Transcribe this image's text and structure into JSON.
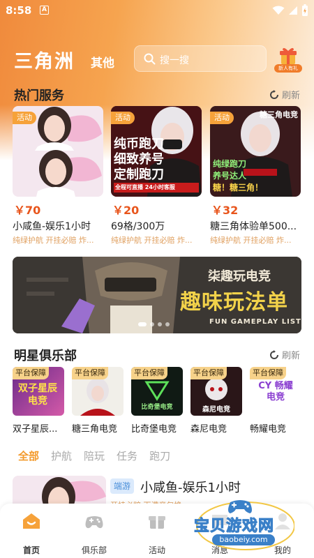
{
  "status_bar": {
    "time": "8:58",
    "notification_icon": "A"
  },
  "header": {
    "brand": "三角洲",
    "subtitle": "其他",
    "search_placeholder": "搜一搜",
    "gift_label": "新人有礼"
  },
  "hot_services": {
    "title": "热门服务",
    "refresh_label": "刷新",
    "cards": [
      {
        "tag": "活动",
        "price": "￥70",
        "title": "小咸鱼-娱乐1小时",
        "tags": "纯绿护航  开挂必赔  炸..."
      },
      {
        "tag": "活动",
        "price": "￥20",
        "title": "69格/300万",
        "tags": "纯绿护航  开挂必赔  炸...",
        "image_text": [
          "纯币跑刀",
          "细致养号",
          "定制跑刀",
          "全程可直播 24小时客服"
        ]
      },
      {
        "tag": "活动",
        "price": "￥32",
        "title": "糖三角体验单500...",
        "tags": "纯绿护航  开挂必赔  炸...",
        "image_text": [
          "糖三角电竞",
          "纯绿跑刀",
          "养号达人",
          "糖！糖三角！"
        ]
      }
    ]
  },
  "banner": {
    "line1": "柒趣玩电竞",
    "line2": "趣味玩法单",
    "line3": "FUN GAMEPLAY LIST",
    "slides": 4,
    "active_slide": 0
  },
  "star_clubs": {
    "title": "明星俱乐部",
    "refresh_label": "刷新",
    "badge": "平台保障",
    "clubs": [
      {
        "name": "双子星辰...",
        "logo_text": "双子星辰电竞"
      },
      {
        "name": "糖三角电竞",
        "logo_text": ""
      },
      {
        "name": "比奇堡电竞",
        "logo_text": "比奇堡电竞"
      },
      {
        "name": "森尼电竞",
        "logo_text": "森尼电竞"
      },
      {
        "name": "畅耀电竞",
        "logo_text": "CY 畅耀电竞"
      }
    ]
  },
  "filters": [
    "全部",
    "护航",
    "陪玩",
    "任务",
    "跑刀"
  ],
  "active_filter": 0,
  "list_item": {
    "tag": "端游",
    "title": "小咸鱼-娱乐1小时",
    "sub": "开挂必赔   下满竞包换"
  },
  "tabbar": {
    "tabs": [
      "首页",
      "俱乐部",
      "活动",
      "消息",
      "我的"
    ],
    "active": 0
  },
  "watermark": {
    "text": "宝贝游戏网",
    "url": "baobeiy.com"
  },
  "colors": {
    "accent": "#f39a2c",
    "price": "#e8551c",
    "tag_orange": "#f6a23a"
  }
}
